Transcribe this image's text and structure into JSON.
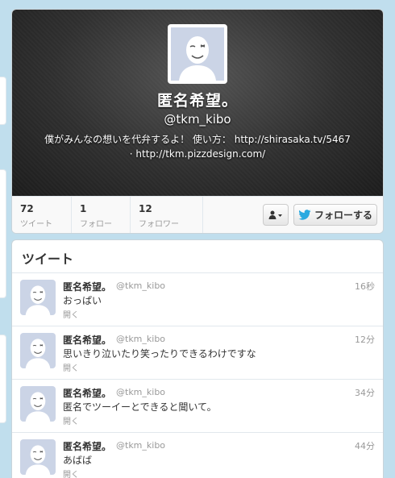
{
  "profile": {
    "name": "匿名希望。",
    "handle": "@tkm_kibo",
    "bio": "僕がみんなの想いを代弁するよ！ 使い方： http://shirasaka.tv/5467",
    "link": "· http://tkm.pizzdesign.com/",
    "avatar_icon": "default-egg-avatar-icon"
  },
  "stats": [
    {
      "value": "72",
      "label": "ツイート"
    },
    {
      "value": "1",
      "label": "フォロー"
    },
    {
      "value": "12",
      "label": "フォロワー"
    }
  ],
  "actions": {
    "user_menu_icon": "person-dropdown-icon",
    "follow_label": "フォローする",
    "follow_icon": "twitter-bird-icon"
  },
  "tweets_section": {
    "title": "ツイート"
  },
  "tweets": [
    {
      "name": "匿名希望。",
      "handle": "@tkm_kibo",
      "time": "16秒",
      "text": "おっぱい",
      "open": "開く"
    },
    {
      "name": "匿名希望。",
      "handle": "@tkm_kibo",
      "time": "12分",
      "text": "思いきり泣いたり笑ったりできるわけですな",
      "open": "開く"
    },
    {
      "name": "匿名希望。",
      "handle": "@tkm_kibo",
      "time": "34分",
      "text": "匿名でツーイーとできると聞いて。",
      "open": "開く"
    },
    {
      "name": "匿名希望。",
      "handle": "@tkm_kibo",
      "time": "44分",
      "text": "あばば",
      "open": "開く"
    }
  ],
  "colors": {
    "background": "#c0deed",
    "header_dark": "#2f2f2f",
    "muted_text": "#999999",
    "twitter_blue": "#2aa9e0"
  }
}
